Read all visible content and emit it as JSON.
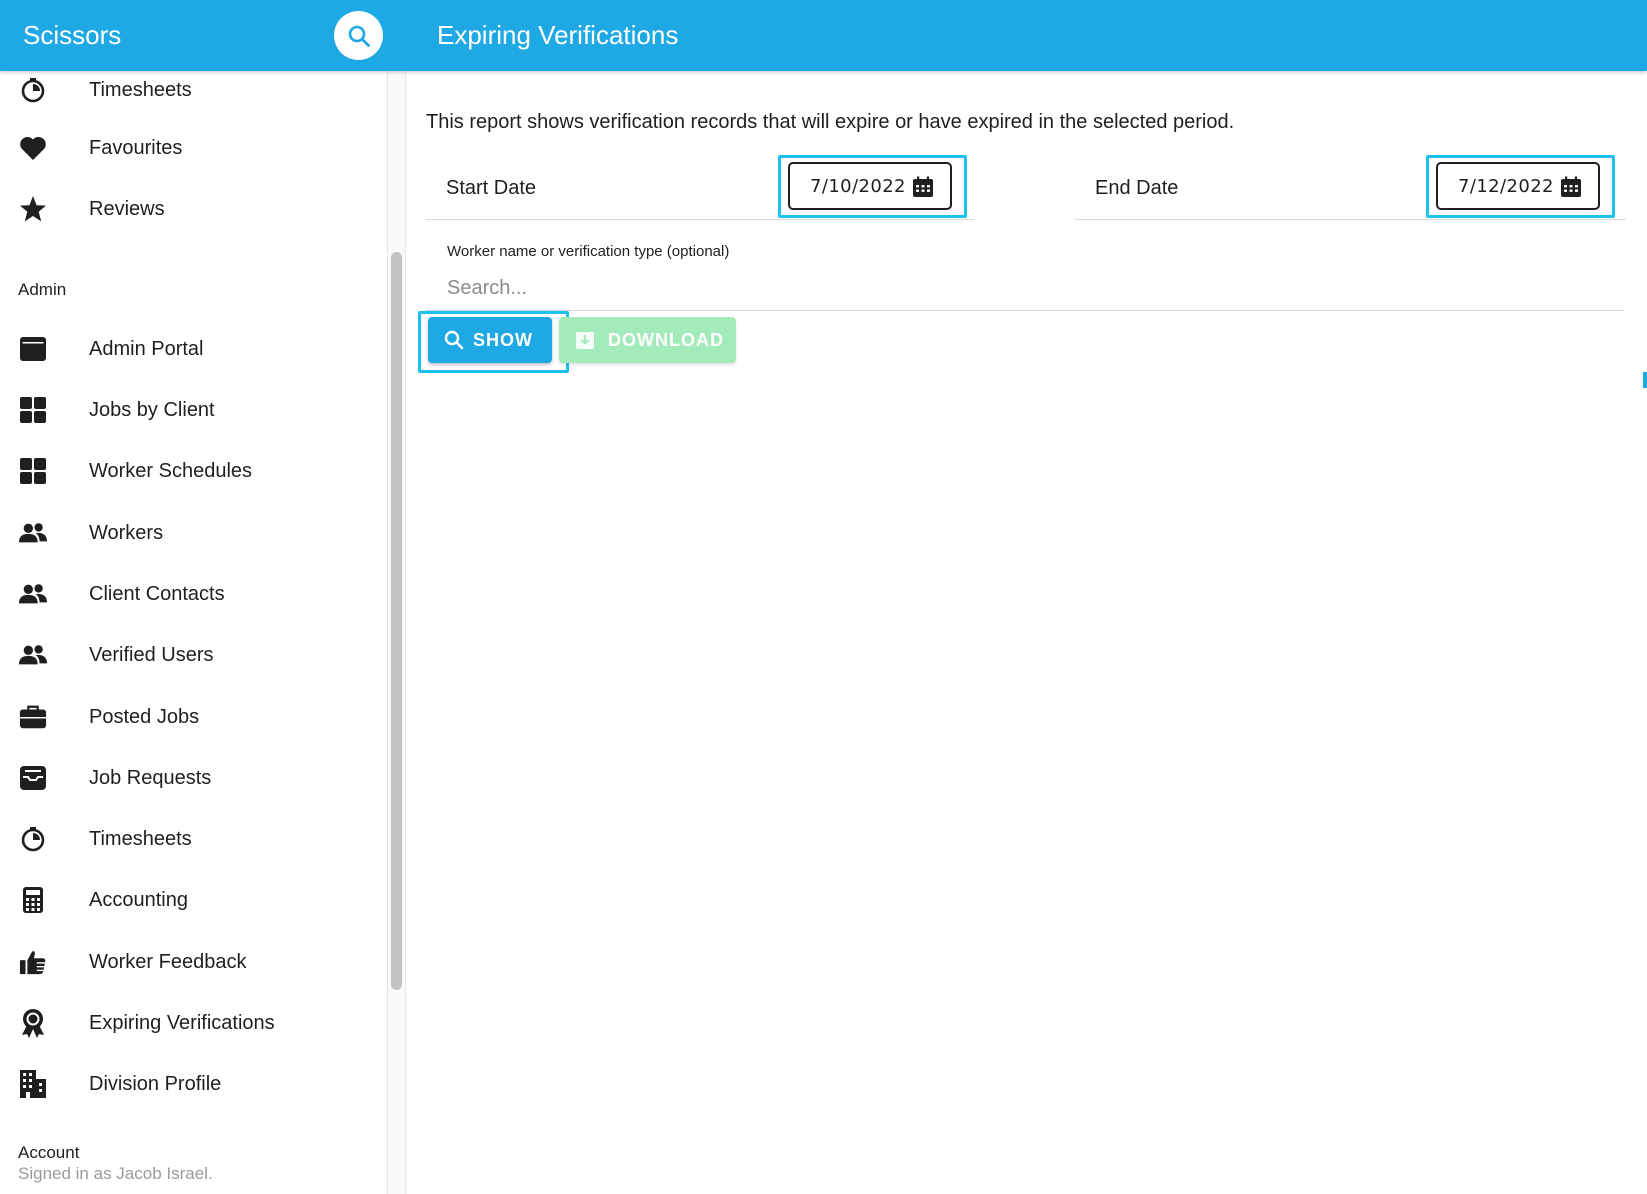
{
  "header": {
    "app_title": "Scissors",
    "page_title": "Expiring Verifications",
    "search_icon": "search-icon",
    "color": "#1ea8e4"
  },
  "sidebar": {
    "top_items": [
      {
        "label": "Timesheets",
        "icon": "stopwatch-icon"
      },
      {
        "label": "Favourites",
        "icon": "heart-icon"
      },
      {
        "label": "Reviews",
        "icon": "star-icon"
      }
    ],
    "admin_header": "Admin",
    "admin_items": [
      {
        "label": "Admin Portal",
        "icon": "browser-window-icon"
      },
      {
        "label": "Jobs by Client",
        "icon": "grid-icon"
      },
      {
        "label": "Worker Schedules",
        "icon": "grid-icon"
      },
      {
        "label": "Workers",
        "icon": "users-icon"
      },
      {
        "label": "Client Contacts",
        "icon": "users-icon"
      },
      {
        "label": "Verified Users",
        "icon": "users-icon"
      },
      {
        "label": "Posted Jobs",
        "icon": "briefcase-icon"
      },
      {
        "label": "Job Requests",
        "icon": "inbox-icon"
      },
      {
        "label": "Timesheets",
        "icon": "stopwatch-icon"
      },
      {
        "label": "Accounting",
        "icon": "calculator-icon"
      },
      {
        "label": "Worker Feedback",
        "icon": "thumbs-up-icon"
      },
      {
        "label": "Expiring Verifications",
        "icon": "award-icon"
      },
      {
        "label": "Division Profile",
        "icon": "building-icon"
      }
    ],
    "account_header": "Account",
    "signed_in_text": "Signed in as Jacob Israel."
  },
  "main": {
    "description": "This report shows verification records that will expire or have expired in the selected period.",
    "start_date": {
      "label": "Start Date",
      "value": "7/10/2022",
      "icon": "calendar-icon"
    },
    "end_date": {
      "label": "End Date",
      "value": "7/12/2022",
      "icon": "calendar-icon"
    },
    "search": {
      "label": "Worker name or verification type (optional)",
      "placeholder": "Search...",
      "value": ""
    },
    "show_button": {
      "label": "SHOW",
      "icon": "search-icon",
      "color": "#1ea8e4"
    },
    "download_button": {
      "label": "DOWNLOAD",
      "icon": "download-icon",
      "color": "#a3ebbb"
    },
    "highlight_color": "#1ec1f0"
  }
}
